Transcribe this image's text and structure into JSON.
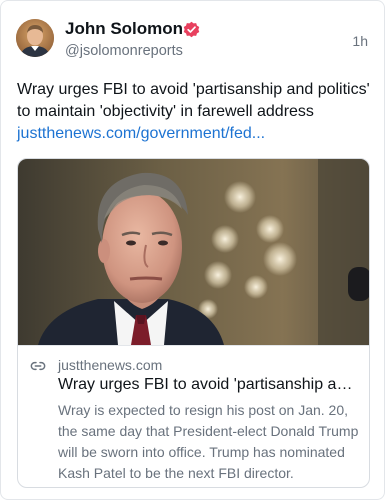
{
  "author": {
    "name": "John Solomon",
    "handle": "@jsolomonreports",
    "verified_badge_icon": "verified-badge-icon",
    "avatar_icon": "avatar-photo"
  },
  "post": {
    "timestamp": "1h",
    "text": "Wray urges FBI to avoid 'partisanship and politics' to maintain 'objectivity' in farewell address ",
    "link_text": "justthenews.com/government/fed..."
  },
  "link_card": {
    "image": "card-photo",
    "icon": "link-icon",
    "domain": "justthenews.com",
    "title": "Wray urges FBI to avoid 'partisanship and politics' to maintain 'objectivity' in farewell address",
    "description": "Wray is expected to resign his post on Jan. 20, the same day that President-elect Donald Trump will be sworn into office. Trump has nominated Kash Patel to be the next FBI director."
  },
  "colors": {
    "text": "#0f1419",
    "muted": "#69727d",
    "link": "#1d73d2",
    "verified": "#e8405e",
    "border": "#e3e6ea"
  }
}
